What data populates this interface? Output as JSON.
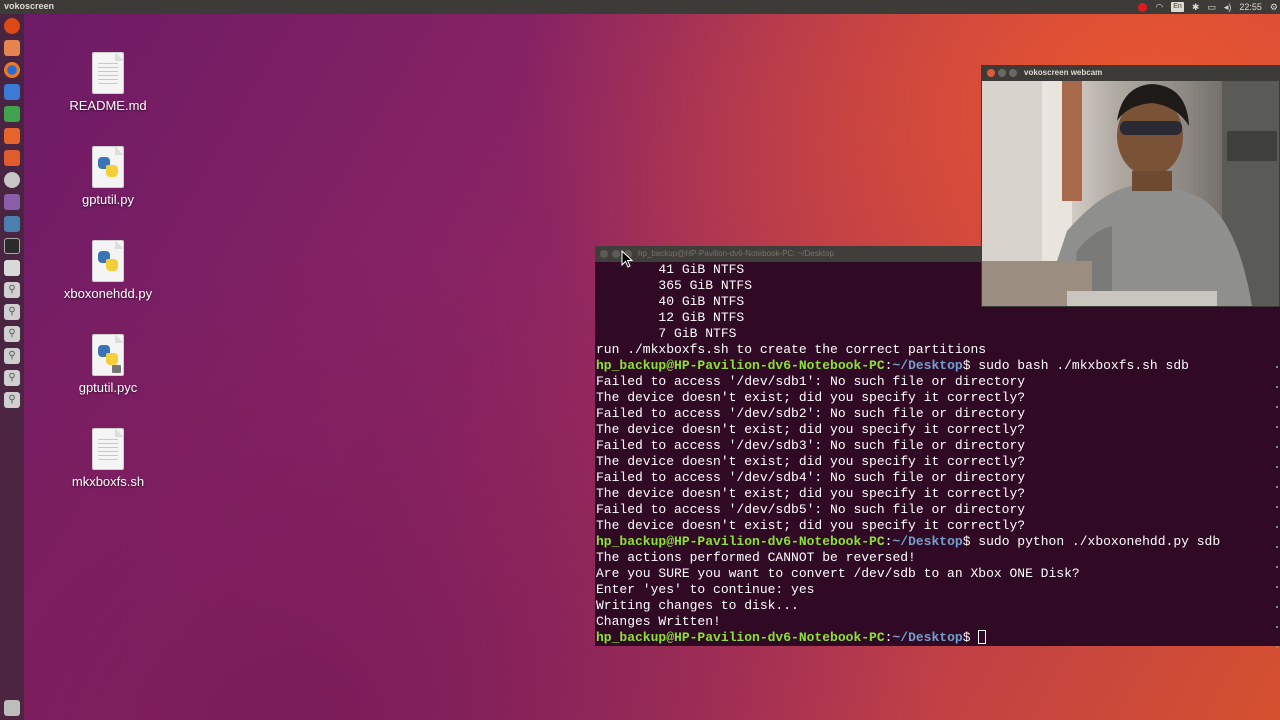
{
  "top_panel": {
    "app_title": "vokoscreen",
    "tray": {
      "keyboard": "En",
      "clock": "22:55"
    }
  },
  "launcher": {
    "items": [
      "dash-icon",
      "files-icon",
      "firefox-icon",
      "writer-icon",
      "calc-icon",
      "impress-icon",
      "software-center-icon",
      "settings-icon",
      "text-editor-icon",
      "vokoscreen-icon",
      "terminal-icon",
      "drive-icon",
      "usb-icon",
      "usb-icon",
      "usb-icon",
      "usb-icon",
      "usb-icon",
      "usb-icon",
      "trash-icon"
    ]
  },
  "desktop": {
    "icons": [
      {
        "label": "README.md",
        "type": "text"
      },
      {
        "label": "gptutil.py",
        "type": "python"
      },
      {
        "label": "xboxonehdd.py",
        "type": "python"
      },
      {
        "label": "gptutil.pyc",
        "type": "python-locked"
      },
      {
        "label": "mkxboxfs.sh",
        "type": "script"
      }
    ]
  },
  "terminal": {
    "title": "hp_backup@HP-Pavilion-dv6-Notebook-PC: ~/Desktop",
    "prompt_user": "hp_backup@HP-Pavilion-dv6-Notebook-PC",
    "prompt_path": "~/Desktop",
    "lines": {
      "l1": "        41 GiB NTFS",
      "l2": "        365 GiB NTFS",
      "l3": "        40 GiB NTFS",
      "l4": "        12 GiB NTFS",
      "l5": "        7 GiB NTFS",
      "l6": "run ./mkxboxfs.sh to create the correct partitions",
      "cmd1": " sudo bash ./mkxboxfs.sh sdb",
      "e1": "Failed to access '/dev/sdb1': No such file or directory",
      "e2": "The device doesn't exist; did you specify it correctly?",
      "e3": "Failed to access '/dev/sdb2': No such file or directory",
      "e4": "The device doesn't exist; did you specify it correctly?",
      "e5": "Failed to access '/dev/sdb3': No such file or directory",
      "e6": "The device doesn't exist; did you specify it correctly?",
      "e7": "Failed to access '/dev/sdb4': No such file or directory",
      "e8": "The device doesn't exist; did you specify it correctly?",
      "e9": "Failed to access '/dev/sdb5': No such file or directory",
      "e10": "The device doesn't exist; did you specify it correctly?",
      "cmd2": " sudo python ./xboxonehdd.py sdb",
      "o1": "The actions performed CANNOT be reversed!",
      "o2": "Are you SURE you want to convert /dev/sdb to an Xbox ONE Disk?",
      "o3": "Enter 'yes' to continue: yes",
      "o4": "Writing changes to disk...",
      "o5": "Changes Written!"
    }
  },
  "webcam": {
    "title": "vokoscreen webcam"
  }
}
